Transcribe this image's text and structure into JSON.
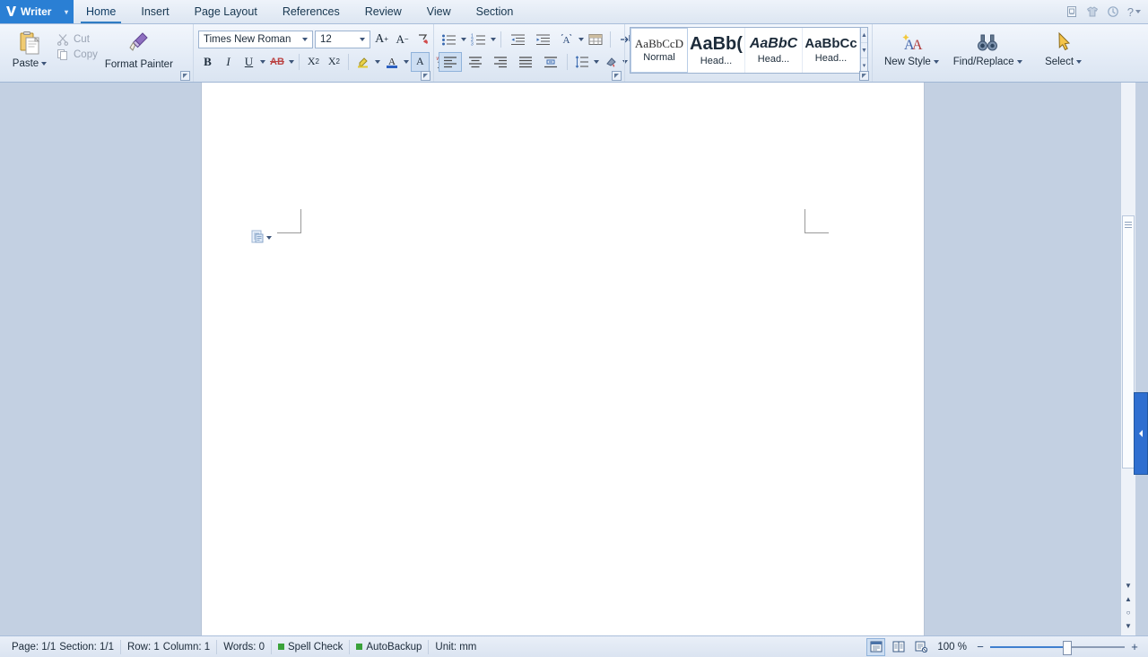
{
  "app": {
    "name": "Writer",
    "logo_caret": "▾"
  },
  "tabs": [
    {
      "label": "Home",
      "active": true
    },
    {
      "label": "Insert",
      "active": false
    },
    {
      "label": "Page Layout",
      "active": false
    },
    {
      "label": "References",
      "active": false
    },
    {
      "label": "Review",
      "active": false
    },
    {
      "label": "View",
      "active": false
    },
    {
      "label": "Section",
      "active": false
    }
  ],
  "title_right_icons": [
    {
      "name": "document-badge-icon"
    },
    {
      "name": "tshirt-skin-icon"
    },
    {
      "name": "undo-history-icon"
    },
    {
      "name": "help-icon",
      "label": "?"
    }
  ],
  "ribbon": {
    "clipboard": {
      "paste": {
        "label": "Paste",
        "caret": "▾"
      },
      "cut": {
        "label": "Cut",
        "enabled": false
      },
      "copy": {
        "label": "Copy",
        "enabled": false
      },
      "format_painter": {
        "label": "Format Painter"
      }
    },
    "font": {
      "font_name": {
        "value": "Times New Roman",
        "caret": "▾"
      },
      "font_size": {
        "value": "12",
        "caret": "▾"
      },
      "grow_font": "A",
      "shrink_font": "A",
      "clear_formatting": "clear-formatting-icon",
      "bold": "B",
      "italic": "I",
      "underline": "U",
      "strikethrough": "AB",
      "superscript": "X",
      "subscript": "X",
      "highlight": "highlight-icon",
      "font_color": "A",
      "character_shading": "A",
      "phonetic_guide": "phonetic-guide-icon"
    },
    "paragraph": {
      "bullets": "bullets-icon",
      "numbering": "numbering-icon",
      "decrease_indent": "decrease-indent-icon",
      "increase_indent": "increase-indent-icon",
      "asian_layout": "asian-layout-icon",
      "table_grid": "table-grid-icon",
      "show_marks": "show-formatting-marks-icon",
      "paragraph_settings": "paragraph-settings-icon",
      "align_left": "align-left-icon",
      "align_center": "align-center-icon",
      "align_right": "align-right-icon",
      "justify": "justify-icon",
      "distributed": "distributed-icon",
      "line_spacing": "line-spacing-icon",
      "shading": "shading-icon",
      "borders": "borders-icon"
    },
    "styles": {
      "items": [
        {
          "preview": "AaBbCcD",
          "name": "Normal",
          "selected": true
        },
        {
          "preview": "AaBb(",
          "name": "Head...",
          "selected": false
        },
        {
          "preview": "AaBbC",
          "name": "Head...",
          "selected": false
        },
        {
          "preview": "AaBbCc",
          "name": "Head...",
          "selected": false
        }
      ],
      "nav_up": "▲",
      "nav_down": "▼",
      "nav_more": "▾"
    },
    "commands": [
      {
        "label": "New Style",
        "caret": "▾",
        "icon": "new-style-icon"
      },
      {
        "label": "Find/Replace",
        "caret": "▾",
        "icon": "find-replace-icon"
      },
      {
        "label": "Select",
        "caret": "▾",
        "icon": "select-icon"
      }
    ]
  },
  "document": {
    "paste_options_icon": "paste-options-icon",
    "paste_options_caret": "▾"
  },
  "scrollbar": {
    "prev_page": "▼",
    "browse_up": "▲",
    "browse_object": "○",
    "next_page": "▼"
  },
  "status": {
    "page": "Page: 1/1",
    "section": "Section: 1/1",
    "row": "Row: 1",
    "column": "Column: 1",
    "words": "Words: 0",
    "spell_check": "Spell Check",
    "autobackup": "AutoBackup",
    "unit": "Unit: mm",
    "views": [
      {
        "name": "print-layout-view",
        "active": true
      },
      {
        "name": "full-screen-reading-view",
        "active": false
      },
      {
        "name": "web-layout-view",
        "active": false
      }
    ],
    "zoom_level": "100 %",
    "zoom_out": "−",
    "zoom_in": "+"
  },
  "colors": {
    "accent": "#2a7fd4",
    "ribbon_bg": "#e3ebf6",
    "workspace_bg": "#c3d0e2",
    "status_green": "#3aa23a"
  }
}
